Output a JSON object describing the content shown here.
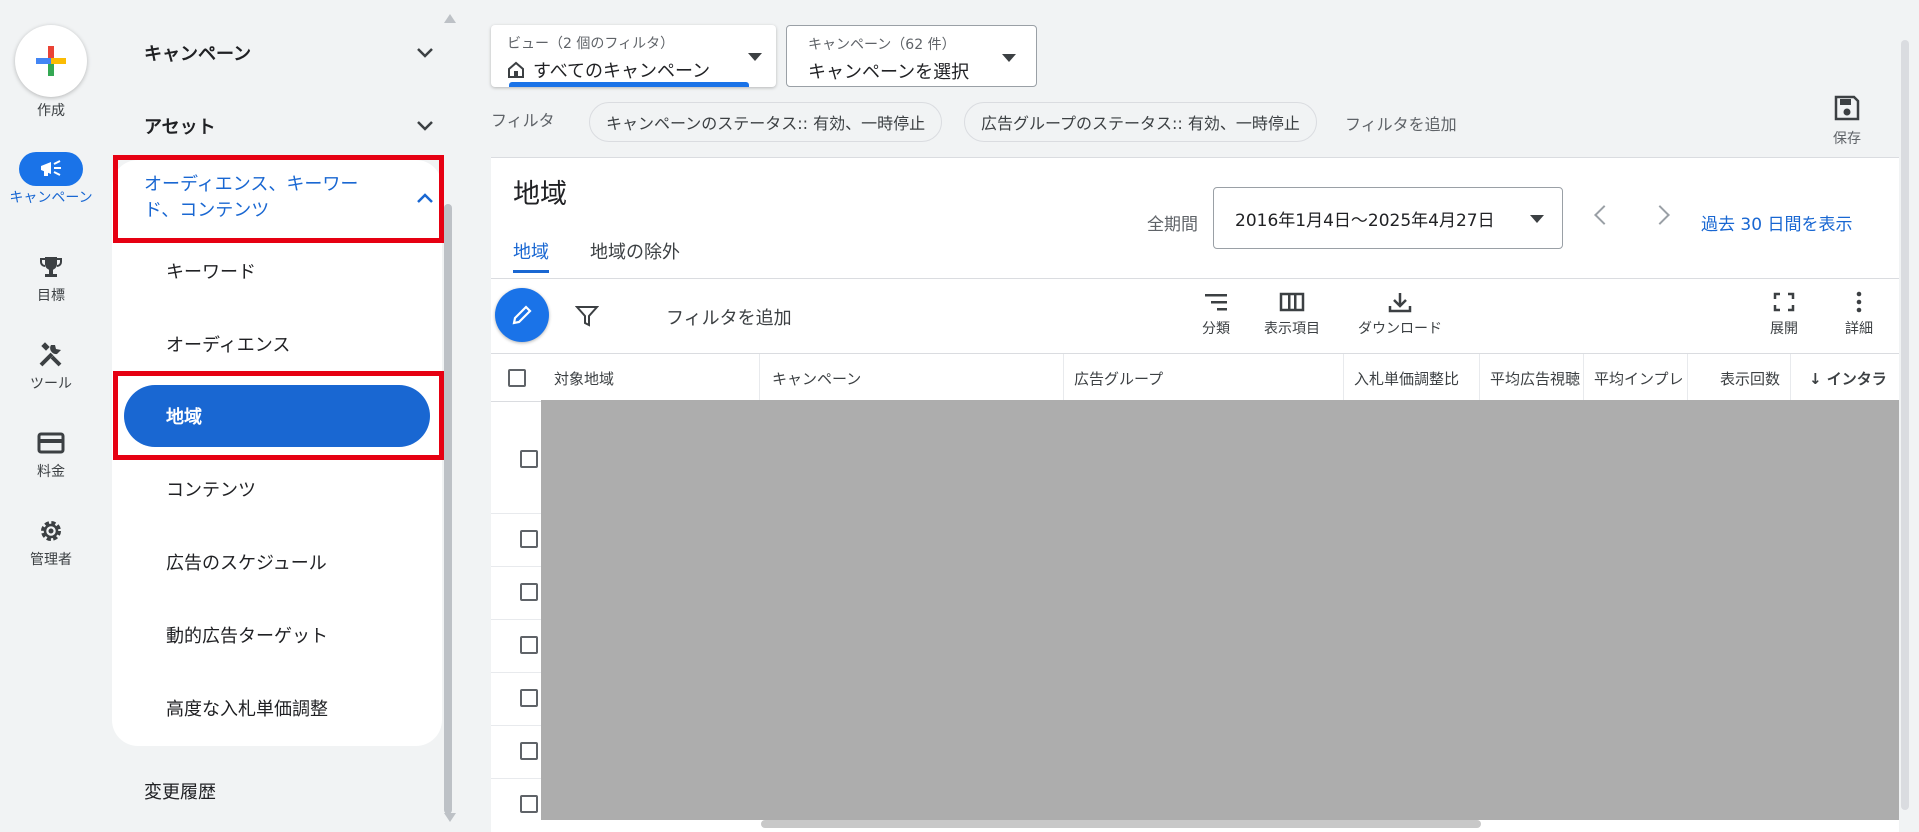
{
  "rail": {
    "create_label": "作成",
    "items": [
      {
        "label": "キャンペーン",
        "icon": "megaphone-icon"
      },
      {
        "label": "目標",
        "icon": "trophy-icon"
      },
      {
        "label": "ツール",
        "icon": "tools-icon"
      },
      {
        "label": "料金",
        "icon": "credit-card-icon"
      },
      {
        "label": "管理者",
        "icon": "gear-icon"
      }
    ]
  },
  "nav": {
    "campaigns": "キャンペーン",
    "assets": "アセット",
    "expanded_section": "オーディエンス、キーワード、コンテンツ",
    "sub_items": [
      "キーワード",
      "オーディエンス",
      "地域",
      "コンテンツ",
      "広告のスケジュール",
      "動的広告ターゲット",
      "高度な入札単価調整"
    ],
    "active_item": "地域",
    "change_history": "変更履歴"
  },
  "filters": {
    "view_sub": "ビュー（2 個のフィルタ）",
    "view_main": "すべてのキャンペーン",
    "campaign_sub": "キャンペーン（62 件）",
    "campaign_main": "キャンペーンを選択",
    "filter_label": "フィルタ",
    "chips": [
      "キャンペーンのステータス:: 有効、一時停止",
      "広告グループのステータス:: 有効、一時停止"
    ],
    "add_filter": "フィルタを追加",
    "save_label": "保存"
  },
  "main": {
    "title": "地域",
    "tabs": [
      "地域",
      "地域の除外"
    ],
    "active_tab": "地域",
    "period_label": "全期間",
    "date_range": "2016年1月4日〜2025年4月27日",
    "last_30": "過去 30 日間を表示",
    "toolbar": {
      "add_filter": "フィルタを追加",
      "segment": "分類",
      "columns": "表示項目",
      "download": "ダウンロード",
      "expand": "展開",
      "more": "詳細"
    },
    "columns": [
      "対象地域",
      "キャンペーン",
      "広告グループ",
      "入札単価調整比",
      "平均広告視聴",
      "平均インプレ",
      "表示回数",
      "↓ インタラ"
    ]
  },
  "colors": {
    "accent": "#1a73e8",
    "highlight_box": "#e60012",
    "redacted": "#adadad"
  }
}
